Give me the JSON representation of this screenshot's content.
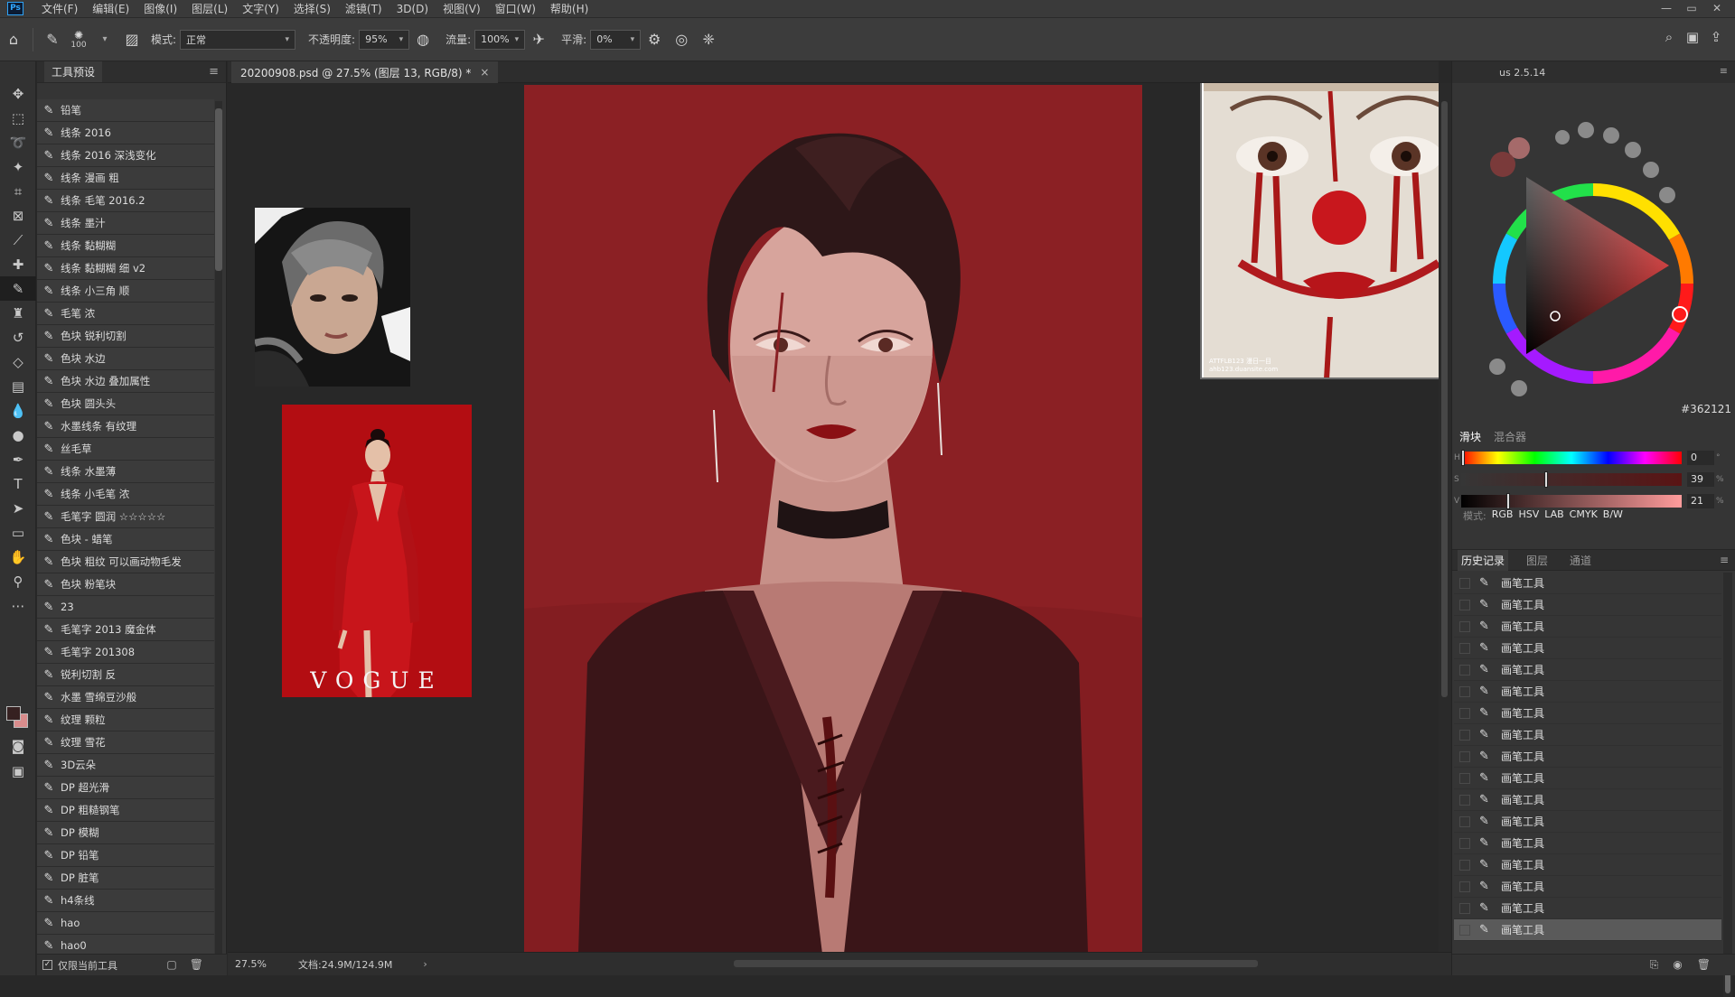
{
  "app": {
    "logo": "Ps"
  },
  "menu": [
    "文件(F)",
    "编辑(E)",
    "图像(I)",
    "图层(L)",
    "文字(Y)",
    "选择(S)",
    "滤镜(T)",
    "3D(D)",
    "视图(V)",
    "窗口(W)",
    "帮助(H)"
  ],
  "window_controls": [
    "—",
    "▭",
    "✕"
  ],
  "options_bar": {
    "brush_size": "100",
    "mode_label": "模式:",
    "mode_value": "正常",
    "opacity_label": "不透明度:",
    "opacity_value": "95%",
    "flow_label": "流量:",
    "flow_value": "100%",
    "smoothing_label": "平滑:",
    "smoothing_value": "0%"
  },
  "presets_panel": {
    "tab": "工具预设",
    "items": [
      "铅笔",
      "线条 2016",
      "线条 2016 深浅变化",
      "线条 漫画 粗",
      "线条 毛笔 2016.2",
      "线条 墨汁",
      "线条 黏糊糊",
      "线条 黏糊糊 细 v2",
      "线条 小三角 顺",
      "毛笔 浓",
      "色块 锐利切割",
      "色块 水边",
      "色块 水边 叠加属性",
      "色块 圆头头",
      "水墨线条 有纹理",
      "丝毛草",
      "线条 水墨薄",
      "线条 小毛笔 浓",
      "毛笔字 圆润 ☆☆☆☆☆",
      "色块 - 蜡笔",
      "色块 粗纹 可以画动物毛发",
      "色块 粉笔块",
      "23",
      "毛笔字 2013 魔金体",
      "毛笔字 201308",
      "锐利切割 反",
      "水墨 雪绵豆沙般",
      "纹理 颗粒",
      "纹理 雪花",
      "3D云朵",
      "DP 超光滑",
      "DP 粗糙钢笔",
      "DP 模糊",
      "DP 铅笔",
      "DP 脏笔",
      "h4条线",
      "hao",
      "hao0"
    ],
    "footer_label": "仅限当前工具"
  },
  "document": {
    "tab_title": "20200908.psd @ 27.5% (图层 13, RGB/8) *",
    "reference_text": "VOGUE",
    "ref3_caption_1": "ATTFLB123 漫日一目",
    "ref3_caption_2": "ahb123.duansite.com"
  },
  "status": {
    "zoom": "27.5%",
    "doc_info": "文档:24.9M/124.9M"
  },
  "color_panel": {
    "header": "us 2.5.14",
    "hex": "#362121",
    "tabs": [
      "滑块",
      "混合器"
    ],
    "sliders": [
      {
        "label": "H",
        "value": "0",
        "unit": "°"
      },
      {
        "label": "S",
        "value": "39",
        "unit": "%"
      },
      {
        "label": "V",
        "value": "21",
        "unit": "%"
      }
    ],
    "mode_label": "模式:",
    "modes": [
      "RGB",
      "HSV",
      "LAB",
      "CMYK",
      "B/W"
    ],
    "fg_color": "#362121",
    "bg_color": "#d98c8c"
  },
  "history_panel": {
    "tabs": [
      "历史记录",
      "图层",
      "通道"
    ],
    "items": [
      "画笔工具",
      "画笔工具",
      "画笔工具",
      "画笔工具",
      "画笔工具",
      "画笔工具",
      "画笔工具",
      "画笔工具",
      "画笔工具",
      "画笔工具",
      "画笔工具",
      "画笔工具",
      "画笔工具",
      "画笔工具",
      "画笔工具",
      "画笔工具",
      "画笔工具"
    ]
  },
  "icons": {
    "tools": [
      "move-icon",
      "marquee-icon",
      "lasso-icon",
      "magic-wand-icon",
      "crop-icon",
      "frame-icon",
      "eyedropper-icon",
      "healing-icon",
      "brush-icon",
      "stamp-icon",
      "history-brush-icon",
      "eraser-icon",
      "gradient-icon",
      "blur-icon",
      "dodge-icon",
      "pen-icon",
      "type-icon",
      "path-select-icon",
      "rectangle-icon",
      "hand-icon",
      "zoom-icon",
      "more-icon"
    ]
  }
}
